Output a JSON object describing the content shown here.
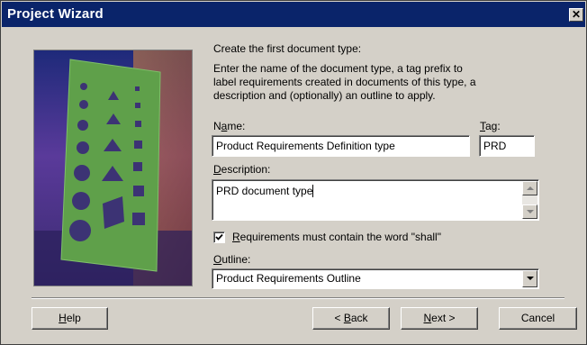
{
  "window": {
    "title": "Project Wizard",
    "close_glyph": "✕"
  },
  "intro": {
    "heading": "Create the first document type:",
    "line1": "Enter the name of the document type, a tag prefix to",
    "line2": "label requirements created in documents of this type, a",
    "line3": "description and (optionally) an outline to apply."
  },
  "name": {
    "label_prefix": "N",
    "label_key": "a",
    "label_rest": "me:",
    "value": "Product Requirements Definition type"
  },
  "tag": {
    "label_key": "T",
    "label_rest": "ag:",
    "value": "PRD"
  },
  "description": {
    "label_key": "D",
    "label_rest": "escription:",
    "value": "PRD document type"
  },
  "shall_checkbox": {
    "checked": true,
    "label_key": "R",
    "label_rest": "equirements must contain the word \"shall\""
  },
  "outline": {
    "label_key": "O",
    "label_rest": "utline:",
    "value": "Product Requirements Outline"
  },
  "buttons": {
    "help": {
      "key": "H",
      "rest": "elp"
    },
    "back": {
      "pre": "< ",
      "key": "B",
      "rest": "ack"
    },
    "next": {
      "key": "N",
      "rest": "ext >"
    },
    "cancel": "Cancel"
  },
  "colors": {
    "titlebar": "#0a246a",
    "face": "#d4d0c8",
    "image_green": "#5fa04a"
  },
  "icons": [
    "close-icon",
    "scroll-up-icon",
    "scroll-down-icon",
    "dropdown-arrow-icon",
    "checkmark-icon"
  ]
}
